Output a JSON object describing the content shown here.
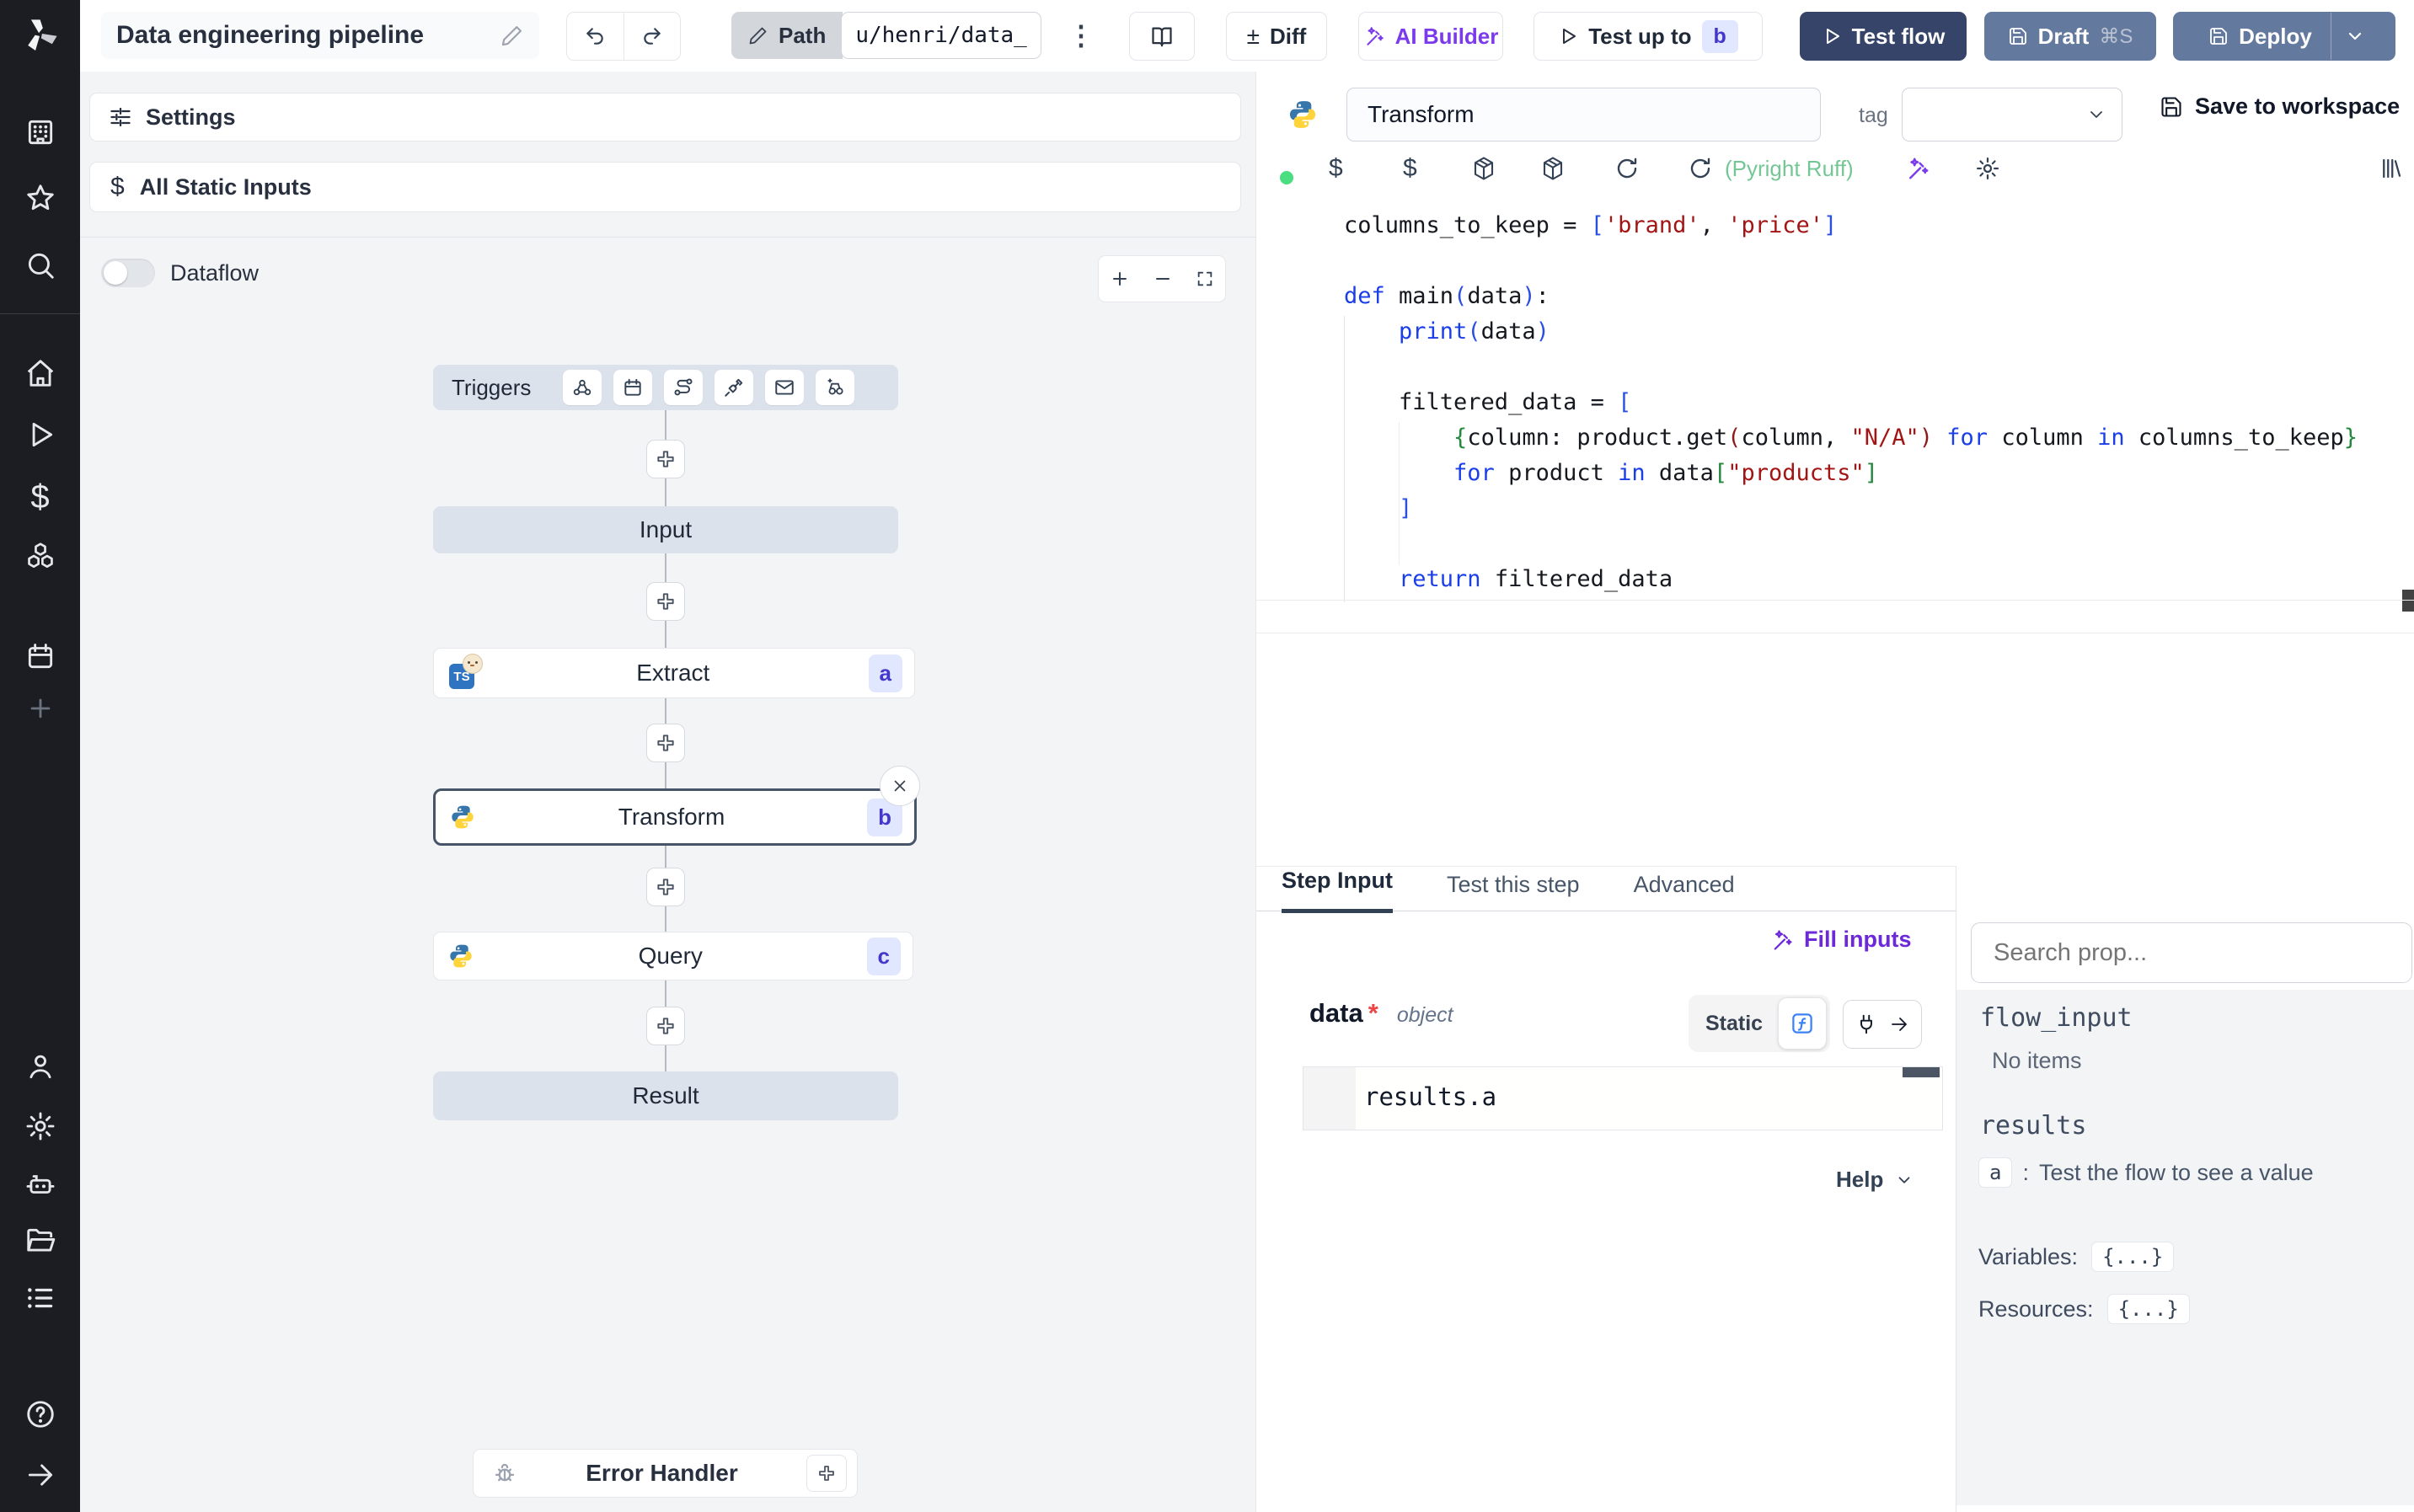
{
  "colors": {
    "sidebar_bg": "#1b1d22",
    "accent_purple": "#7c3aed",
    "primary_navy": "#364469",
    "slate_button": "#64799e",
    "badge_bg": "#e0e7ff",
    "badge_text": "#4338ca",
    "status_green": "#4ade80",
    "lint_green": "#74c794",
    "node_gray": "#dbe2eb"
  },
  "sidebar": {
    "top_icons": [
      "workspace-building",
      "favorites-star",
      "search"
    ],
    "main_icons": [
      "home",
      "runs-play",
      "variables-dollar",
      "resources-cubes",
      "schedules-calendar",
      "add-plus"
    ],
    "bottom_icons": [
      "user",
      "settings-gear",
      "workers-robot",
      "folders",
      "logs-list",
      "help",
      "collapse-arrow"
    ]
  },
  "topbar": {
    "title": "Data engineering pipeline",
    "path_label": "Path",
    "path_value": "u/henri/data_",
    "diff_label": "Diff",
    "ai_builder_label": "AI Builder",
    "test_up_to_label": "Test up to",
    "test_up_to_badge": "b",
    "test_flow_label": "Test flow",
    "draft_label": "Draft",
    "draft_shortcut": "⌘S",
    "deploy_label": "Deploy"
  },
  "flow_panel": {
    "settings_label": "Settings",
    "static_inputs_label": "All Static Inputs",
    "dataflow_label": "Dataflow",
    "trigger_icons": [
      "webhook",
      "schedule-calendar",
      "http-route",
      "websocket-plug",
      "email",
      "poll-watch"
    ],
    "nodes": {
      "triggers_label": "Triggers",
      "input_label": "Input",
      "extract": {
        "label": "Extract",
        "badge": "a",
        "language": "bun-typescript"
      },
      "transform": {
        "label": "Transform",
        "badge": "b",
        "language": "python"
      },
      "query": {
        "label": "Query",
        "badge": "c",
        "language": "python"
      },
      "result_label": "Result",
      "error_handler_label": "Error Handler"
    }
  },
  "editor": {
    "step_name": "Transform",
    "tag_label": "tag",
    "save_label": "Save to workspace",
    "lint_label": "(Pyright Ruff)",
    "toolbar_icons": [
      "status-dot",
      "dollar-var",
      "dollar-var",
      "package",
      "package",
      "refresh",
      "refresh",
      "ai-wand",
      "gear",
      "library"
    ],
    "code_lines": [
      [
        [
          "d",
          "columns_to_keep = "
        ],
        [
          "b",
          "["
        ],
        [
          "s",
          "'brand'"
        ],
        [
          "d",
          ", "
        ],
        [
          "s",
          "'price'"
        ],
        [
          "b",
          "]"
        ]
      ],
      [],
      [
        [
          "k",
          "def"
        ],
        [
          "d",
          " main"
        ],
        [
          "b",
          "("
        ],
        [
          "d",
          "data"
        ],
        [
          "b",
          ")"
        ],
        [
          "d",
          ":"
        ]
      ],
      [
        [
          "d",
          "    "
        ],
        [
          "k",
          "print"
        ],
        [
          "b",
          "("
        ],
        [
          "d",
          "data"
        ],
        [
          "b",
          ")"
        ]
      ],
      [],
      [
        [
          "d",
          "    filtered_data = "
        ],
        [
          "b",
          "["
        ]
      ],
      [
        [
          "d",
          "        "
        ],
        [
          "g",
          "{"
        ],
        [
          "d",
          "column: product.get"
        ],
        [
          "r",
          "("
        ],
        [
          "d",
          "column, "
        ],
        [
          "s",
          "\"N/A\""
        ],
        [
          "r",
          ")"
        ],
        [
          "d",
          " "
        ],
        [
          "k",
          "for"
        ],
        [
          "d",
          " column "
        ],
        [
          "k",
          "in"
        ],
        [
          "d",
          " columns_to_keep"
        ],
        [
          "g",
          "}"
        ]
      ],
      [
        [
          "d",
          "        "
        ],
        [
          "k",
          "for"
        ],
        [
          "d",
          " product "
        ],
        [
          "k",
          "in"
        ],
        [
          "d",
          " data"
        ],
        [
          "g",
          "["
        ],
        [
          "s",
          "\"products\""
        ],
        [
          "g",
          "]"
        ]
      ],
      [
        [
          "d",
          "    "
        ],
        [
          "b",
          "]"
        ]
      ],
      [],
      [
        [
          "d",
          "    "
        ],
        [
          "k",
          "return"
        ],
        [
          "d",
          " filtered_data"
        ]
      ]
    ]
  },
  "step_panel": {
    "tabs": [
      {
        "label": "Step Input"
      },
      {
        "label": "Test this step"
      },
      {
        "label": "Advanced"
      }
    ],
    "fill_inputs_label": "Fill inputs",
    "arg_name": "data",
    "arg_required": "*",
    "arg_type": "object",
    "static_label": "Static",
    "expr_value": "results.a",
    "help_label": "Help"
  },
  "props_panel": {
    "search_placeholder": "Search prop...",
    "flow_input_label": "flow_input",
    "no_items_label": "No items",
    "results_label": "results",
    "result_key": "a",
    "result_separator": ":",
    "result_hint": "Test the flow to see a value",
    "variables_label": "Variables:",
    "variables_value": "{...}",
    "resources_label": "Resources:",
    "resources_value": "{...}"
  }
}
